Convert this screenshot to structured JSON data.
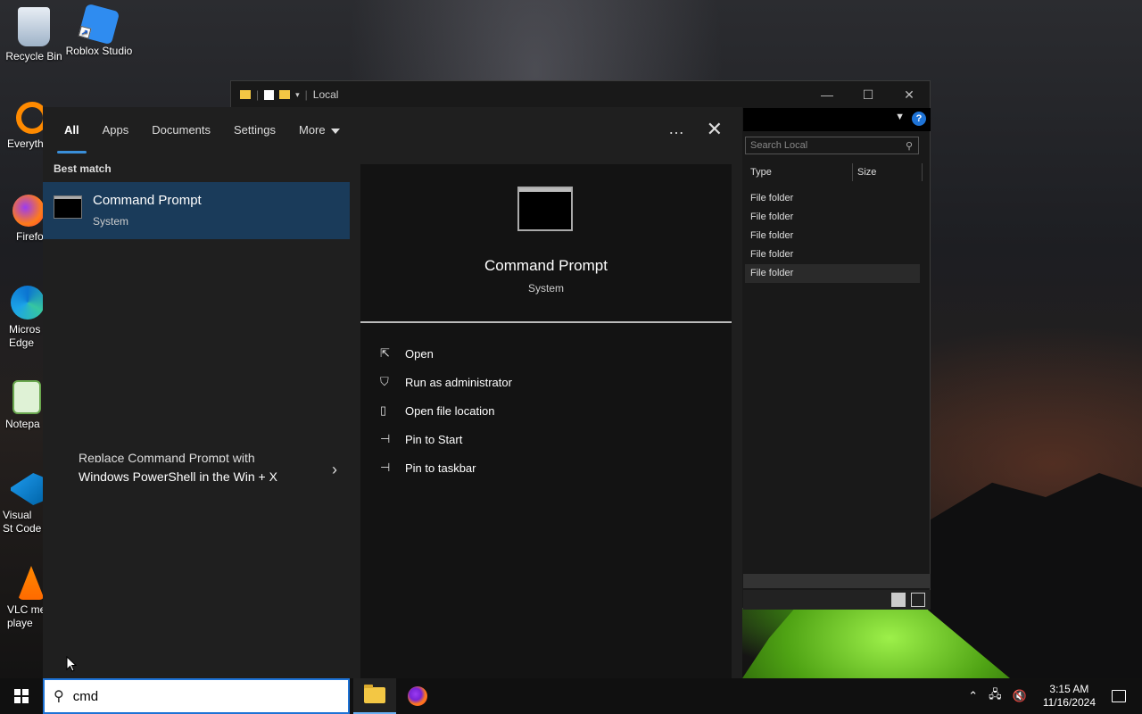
{
  "desktop_icons": [
    {
      "label": "Recycle Bin",
      "icon": "recycle-bin-icon"
    },
    {
      "label": "Roblox Studio",
      "icon": "roblox-studio-icon"
    },
    {
      "label": "Everyth",
      "icon": "everything-search-icon"
    },
    {
      "label": "Firefo",
      "icon": "firefox-icon"
    },
    {
      "label": "Micros Edge",
      "icon": "edge-icon"
    },
    {
      "label": "Notepa",
      "icon": "notepad-icon"
    },
    {
      "label": "Visual St Code",
      "icon": "vscode-icon"
    },
    {
      "label": "VLC me playe",
      "icon": "vlc-icon"
    }
  ],
  "explorer": {
    "title": "Local",
    "search_placeholder": "Search Local",
    "columns": [
      "Type",
      "Size"
    ],
    "rows": [
      "File folder",
      "File folder",
      "File folder",
      "File folder",
      "File folder"
    ],
    "help": "?"
  },
  "search_panel": {
    "tabs": [
      "All",
      "Apps",
      "Documents",
      "Settings",
      "More"
    ],
    "active_tab": "All",
    "more_icon": "…",
    "best_match_heading": "Best match",
    "best_match": {
      "name": "Command Prompt",
      "kind": "System"
    },
    "tip": {
      "partial_line": "Replace Command Prompt with",
      "main_line": "Windows PowerShell in the Win + X"
    },
    "preview": {
      "name": "Command Prompt",
      "kind": "System",
      "actions": [
        {
          "label": "Open",
          "icon": "open-icon"
        },
        {
          "label": "Run as administrator",
          "icon": "shield-icon"
        },
        {
          "label": "Open file location",
          "icon": "file-location-icon"
        },
        {
          "label": "Pin to Start",
          "icon": "pin-icon"
        },
        {
          "label": "Pin to taskbar",
          "icon": "pin-icon"
        }
      ]
    }
  },
  "taskbar": {
    "search_value": "cmd",
    "time": "3:15 AM",
    "date": "11/16/2024"
  }
}
